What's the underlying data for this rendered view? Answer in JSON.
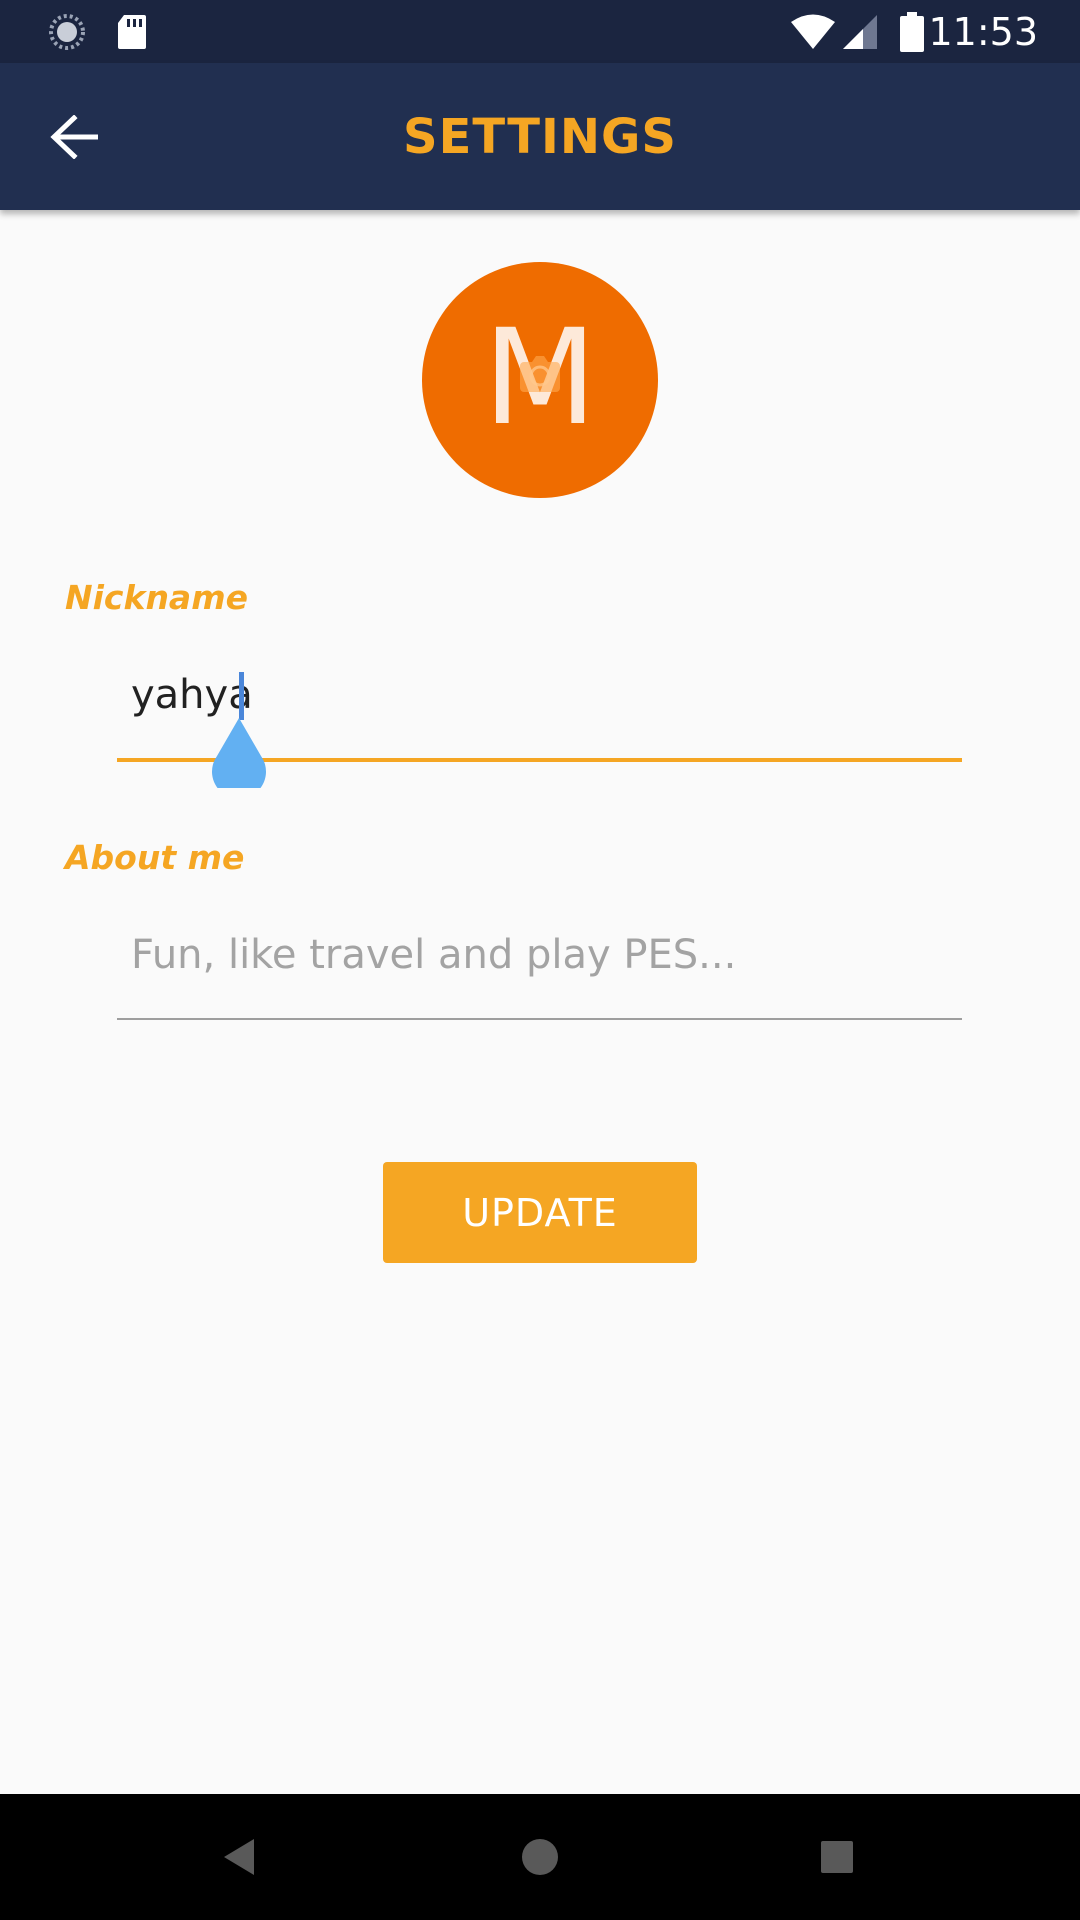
{
  "status_bar": {
    "time": "11:53",
    "icons": [
      "sync-icon",
      "sd-card-icon",
      "wifi-icon",
      "cell-signal-icon",
      "battery-icon"
    ]
  },
  "app_bar": {
    "title": "SETTINGS",
    "back_icon": "arrow-back-icon"
  },
  "avatar": {
    "letter": "M",
    "background": "#ef6c00",
    "overlay_icon": "camera-icon"
  },
  "form": {
    "nickname": {
      "label": "Nickname",
      "value": "yahya"
    },
    "about": {
      "label": "About me",
      "placeholder": "Fun, like travel and play PES..."
    }
  },
  "update_button": {
    "label": "UPDATE"
  },
  "nav_bar": {
    "icons": [
      "back-triangle-icon",
      "home-circle-icon",
      "recents-square-icon"
    ]
  },
  "colors": {
    "accent": "#f5a623",
    "status_bar": "#1b2540",
    "app_bar": "#212f50",
    "caret_handle": "#62b0f2"
  }
}
